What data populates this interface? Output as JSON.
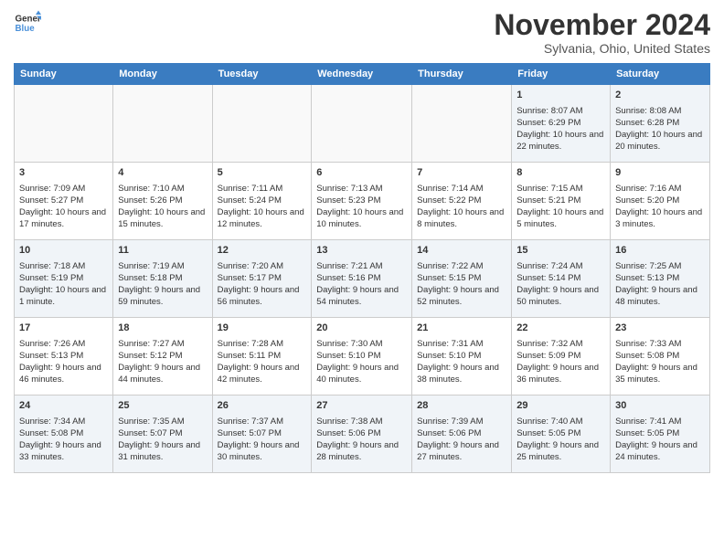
{
  "logo": {
    "line1": "General",
    "line2": "Blue"
  },
  "title": "November 2024",
  "subtitle": "Sylvania, Ohio, United States",
  "days_of_week": [
    "Sunday",
    "Monday",
    "Tuesday",
    "Wednesday",
    "Thursday",
    "Friday",
    "Saturday"
  ],
  "weeks": [
    [
      {
        "day": "",
        "info": ""
      },
      {
        "day": "",
        "info": ""
      },
      {
        "day": "",
        "info": ""
      },
      {
        "day": "",
        "info": ""
      },
      {
        "day": "",
        "info": ""
      },
      {
        "day": "1",
        "info": "Sunrise: 8:07 AM\nSunset: 6:29 PM\nDaylight: 10 hours and 22 minutes."
      },
      {
        "day": "2",
        "info": "Sunrise: 8:08 AM\nSunset: 6:28 PM\nDaylight: 10 hours and 20 minutes."
      }
    ],
    [
      {
        "day": "3",
        "info": "Sunrise: 7:09 AM\nSunset: 5:27 PM\nDaylight: 10 hours and 17 minutes."
      },
      {
        "day": "4",
        "info": "Sunrise: 7:10 AM\nSunset: 5:26 PM\nDaylight: 10 hours and 15 minutes."
      },
      {
        "day": "5",
        "info": "Sunrise: 7:11 AM\nSunset: 5:24 PM\nDaylight: 10 hours and 12 minutes."
      },
      {
        "day": "6",
        "info": "Sunrise: 7:13 AM\nSunset: 5:23 PM\nDaylight: 10 hours and 10 minutes."
      },
      {
        "day": "7",
        "info": "Sunrise: 7:14 AM\nSunset: 5:22 PM\nDaylight: 10 hours and 8 minutes."
      },
      {
        "day": "8",
        "info": "Sunrise: 7:15 AM\nSunset: 5:21 PM\nDaylight: 10 hours and 5 minutes."
      },
      {
        "day": "9",
        "info": "Sunrise: 7:16 AM\nSunset: 5:20 PM\nDaylight: 10 hours and 3 minutes."
      }
    ],
    [
      {
        "day": "10",
        "info": "Sunrise: 7:18 AM\nSunset: 5:19 PM\nDaylight: 10 hours and 1 minute."
      },
      {
        "day": "11",
        "info": "Sunrise: 7:19 AM\nSunset: 5:18 PM\nDaylight: 9 hours and 59 minutes."
      },
      {
        "day": "12",
        "info": "Sunrise: 7:20 AM\nSunset: 5:17 PM\nDaylight: 9 hours and 56 minutes."
      },
      {
        "day": "13",
        "info": "Sunrise: 7:21 AM\nSunset: 5:16 PM\nDaylight: 9 hours and 54 minutes."
      },
      {
        "day": "14",
        "info": "Sunrise: 7:22 AM\nSunset: 5:15 PM\nDaylight: 9 hours and 52 minutes."
      },
      {
        "day": "15",
        "info": "Sunrise: 7:24 AM\nSunset: 5:14 PM\nDaylight: 9 hours and 50 minutes."
      },
      {
        "day": "16",
        "info": "Sunrise: 7:25 AM\nSunset: 5:13 PM\nDaylight: 9 hours and 48 minutes."
      }
    ],
    [
      {
        "day": "17",
        "info": "Sunrise: 7:26 AM\nSunset: 5:13 PM\nDaylight: 9 hours and 46 minutes."
      },
      {
        "day": "18",
        "info": "Sunrise: 7:27 AM\nSunset: 5:12 PM\nDaylight: 9 hours and 44 minutes."
      },
      {
        "day": "19",
        "info": "Sunrise: 7:28 AM\nSunset: 5:11 PM\nDaylight: 9 hours and 42 minutes."
      },
      {
        "day": "20",
        "info": "Sunrise: 7:30 AM\nSunset: 5:10 PM\nDaylight: 9 hours and 40 minutes."
      },
      {
        "day": "21",
        "info": "Sunrise: 7:31 AM\nSunset: 5:10 PM\nDaylight: 9 hours and 38 minutes."
      },
      {
        "day": "22",
        "info": "Sunrise: 7:32 AM\nSunset: 5:09 PM\nDaylight: 9 hours and 36 minutes."
      },
      {
        "day": "23",
        "info": "Sunrise: 7:33 AM\nSunset: 5:08 PM\nDaylight: 9 hours and 35 minutes."
      }
    ],
    [
      {
        "day": "24",
        "info": "Sunrise: 7:34 AM\nSunset: 5:08 PM\nDaylight: 9 hours and 33 minutes."
      },
      {
        "day": "25",
        "info": "Sunrise: 7:35 AM\nSunset: 5:07 PM\nDaylight: 9 hours and 31 minutes."
      },
      {
        "day": "26",
        "info": "Sunrise: 7:37 AM\nSunset: 5:07 PM\nDaylight: 9 hours and 30 minutes."
      },
      {
        "day": "27",
        "info": "Sunrise: 7:38 AM\nSunset: 5:06 PM\nDaylight: 9 hours and 28 minutes."
      },
      {
        "day": "28",
        "info": "Sunrise: 7:39 AM\nSunset: 5:06 PM\nDaylight: 9 hours and 27 minutes."
      },
      {
        "day": "29",
        "info": "Sunrise: 7:40 AM\nSunset: 5:05 PM\nDaylight: 9 hours and 25 minutes."
      },
      {
        "day": "30",
        "info": "Sunrise: 7:41 AM\nSunset: 5:05 PM\nDaylight: 9 hours and 24 minutes."
      }
    ]
  ]
}
